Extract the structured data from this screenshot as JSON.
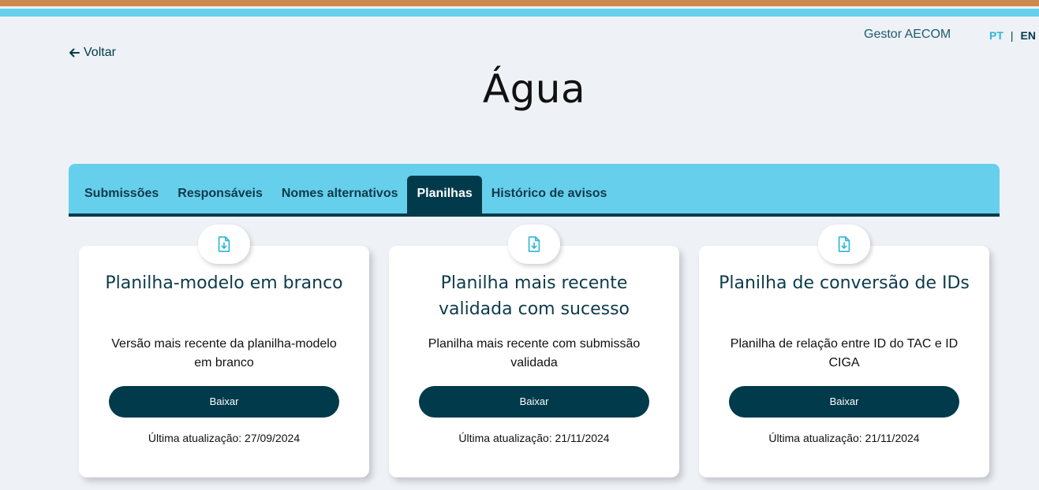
{
  "header": {
    "user_name": "Gestor AECOM",
    "lang_pt": "PT",
    "lang_separator": "|",
    "lang_en": "EN",
    "back_label": "Voltar"
  },
  "page": {
    "title": "Água"
  },
  "tabs": [
    {
      "label": "Submissões",
      "active": false
    },
    {
      "label": "Responsáveis",
      "active": false
    },
    {
      "label": "Nomes alternativos",
      "active": false
    },
    {
      "label": "Planilhas",
      "active": true
    },
    {
      "label": "Histórico de avisos",
      "active": false
    }
  ],
  "cards": [
    {
      "icon": "file-download-icon",
      "title": "Planilha-modelo em branco",
      "description": "Versão mais recente da planilha-modelo em branco",
      "button_label": "Baixar",
      "updated": "Última atualização: 27/09/2024"
    },
    {
      "icon": "file-download-icon",
      "title": "Planilha mais recente validada com sucesso",
      "description": "Planilha mais recente com submissão validada",
      "button_label": "Baixar",
      "updated": "Última atualização: 21/11/2024"
    },
    {
      "icon": "file-download-icon",
      "title": "Planilha de conversão de IDs",
      "description": "Planilha de relação entre ID do TAC e ID CIGA",
      "button_label": "Baixar",
      "updated": "Última atualização: 21/11/2024"
    }
  ],
  "colors": {
    "brand_dark": "#003a4b",
    "accent_blue": "#66cfec",
    "accent_orange": "#cd8a4f",
    "lang_active": "#2fb6d6"
  }
}
